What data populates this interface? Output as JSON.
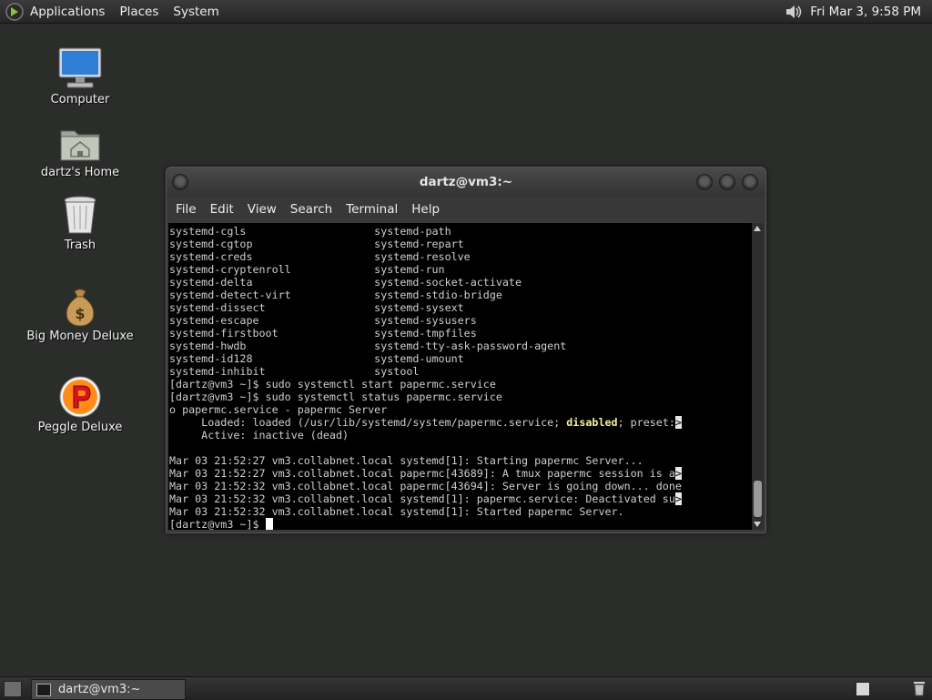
{
  "top_panel": {
    "menus": [
      "Applications",
      "Places",
      "System"
    ],
    "clock": "Fri Mar  3,  9:58 PM"
  },
  "desktop_icons": [
    {
      "label": "Computer",
      "icon": "computer-icon"
    },
    {
      "label": "dartz's Home",
      "icon": "home-folder-icon"
    },
    {
      "label": "Trash",
      "icon": "trash-icon"
    },
    {
      "label": "Big Money Deluxe",
      "icon": "money-bag-icon"
    },
    {
      "label": "Peggle Deluxe",
      "icon": "peggle-icon"
    }
  ],
  "terminal": {
    "title": "dartz@vm3:~",
    "menu": [
      "File",
      "Edit",
      "View",
      "Search",
      "Terminal",
      "Help"
    ],
    "lines": [
      "systemd-cgls                    systemd-path",
      "systemd-cgtop                   systemd-repart",
      "systemd-creds                   systemd-resolve",
      "systemd-cryptenroll             systemd-run",
      "systemd-delta                   systemd-socket-activate",
      "systemd-detect-virt             systemd-stdio-bridge",
      "systemd-dissect                 systemd-sysext",
      "systemd-escape                  systemd-sysusers",
      "systemd-firstboot               systemd-tmpfiles",
      "systemd-hwdb                    systemd-tty-ask-password-agent",
      "systemd-id128                   systemd-umount",
      "systemd-inhibit                 systool",
      "[dartz@vm3 ~]$ sudo systemctl start papermc.service",
      "[dartz@vm3 ~]$ sudo systemctl status papermc.service",
      "o papermc.service - papermc Server",
      "     Loaded: loaded (/usr/lib/systemd/system/papermc.service; ",
      "     Active: inactive (dead)",
      "",
      "Mar 03 21:52:27 vm3.collabnet.local systemd[1]: Starting papermc Server...",
      "Mar 03 21:52:27 vm3.collabnet.local papermc[43689]: A tmux papermc session is a",
      "Mar 03 21:52:32 vm3.collabnet.local papermc[43694]: Server is going down... done",
      "Mar 03 21:52:32 vm3.collabnet.local systemd[1]: papermc.service: Deactivated su",
      "Mar 03 21:52:32 vm3.collabnet.local systemd[1]: Started papermc Server.",
      "[dartz@vm3 ~]$ "
    ],
    "loaded_highlight": "disabled",
    "loaded_tail": "; preset:",
    "overflow_marker": ">"
  },
  "taskbar": {
    "task_label": "dartz@vm3:~"
  }
}
